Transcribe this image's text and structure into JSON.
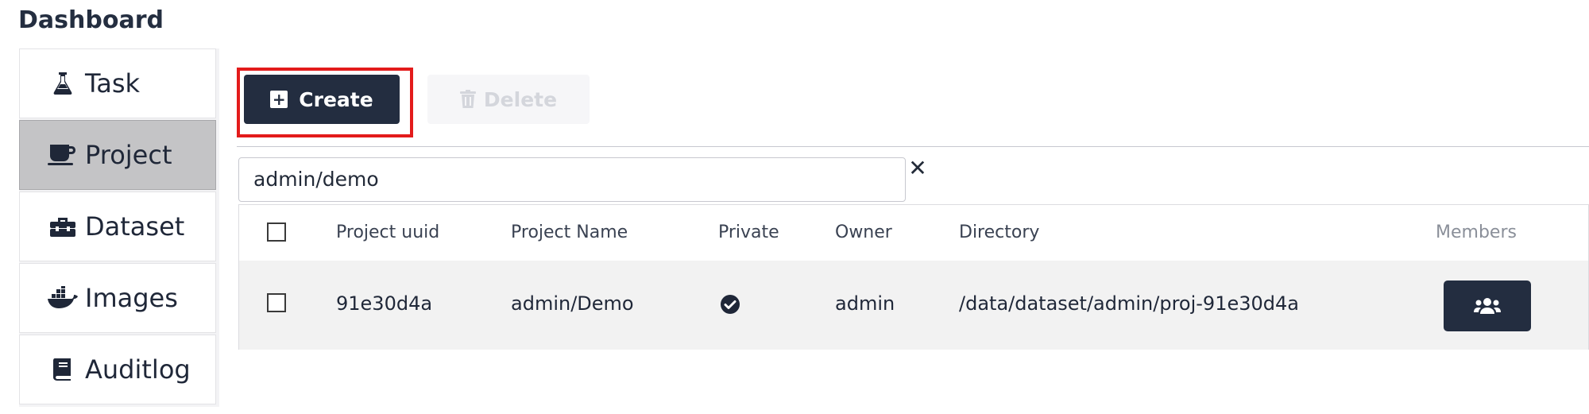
{
  "header": {
    "title": "Dashboard"
  },
  "sidebar": {
    "items": [
      {
        "label": "Task",
        "icon": "flask-icon",
        "active": false
      },
      {
        "label": "Project",
        "icon": "mug-icon",
        "active": true
      },
      {
        "label": "Dataset",
        "icon": "toolbox-icon",
        "active": false
      },
      {
        "label": "Images",
        "icon": "docker-icon",
        "active": false
      },
      {
        "label": "Auditlog",
        "icon": "book-icon",
        "active": false
      }
    ]
  },
  "toolbar": {
    "create_label": "Create",
    "delete_label": "Delete",
    "delete_disabled": true,
    "highlight_color": "#e31b1b"
  },
  "search": {
    "value": "admin/demo",
    "clear_icon": "close-icon"
  },
  "table": {
    "columns": [
      "Project uuid",
      "Project Name",
      "Private",
      "Owner",
      "Directory",
      "Members"
    ],
    "rows": [
      {
        "uuid": "91e30d4a",
        "name": "admin/Demo",
        "private": true,
        "owner": "admin",
        "directory": "/data/dataset/admin/proj-91e30d4a",
        "members_icon": "users-icon"
      }
    ]
  },
  "colors": {
    "primary": "#232d40",
    "sidebar_active": "#c4c4c6",
    "row_background": "#f2f2f2"
  }
}
